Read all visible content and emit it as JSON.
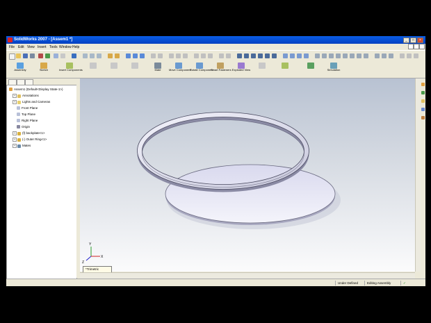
{
  "window": {
    "title": "SolidWorks 2007 - [Assem1 *]",
    "buttons": {
      "minimize": "_",
      "maximize": "□",
      "close": "×"
    }
  },
  "menu": {
    "items": [
      "File",
      "Edit",
      "View",
      "Insert",
      "Tools",
      "Window",
      "Help"
    ]
  },
  "command_manager": {
    "items": [
      {
        "label": "Assembly"
      },
      {
        "label": "Sketch"
      },
      {
        "label": "Insert Components"
      },
      {
        "label": "Mate"
      },
      {
        "label": "Move Component"
      },
      {
        "label": "Rotate Component"
      },
      {
        "label": "Smart Fasteners"
      },
      {
        "label": "Exploded View"
      },
      {
        "label": "Simulation"
      }
    ]
  },
  "feature_tree": {
    "nodes": [
      {
        "label": "Assem1 (Default<Display State-1>)",
        "icon": "assembly-icon"
      },
      {
        "label": "Annotations",
        "icon": "annotations-icon"
      },
      {
        "label": "Lights and Cameras",
        "icon": "lights-icon"
      },
      {
        "label": "Front Plane",
        "icon": "plane-icon"
      },
      {
        "label": "Top Plane",
        "icon": "plane-icon"
      },
      {
        "label": "Right Plane",
        "icon": "plane-icon"
      },
      {
        "label": "Origin",
        "icon": "origin-icon"
      },
      {
        "label": "(f) backplate<1>",
        "icon": "part-icon"
      },
      {
        "label": "(-) Outer Ring<1>",
        "icon": "part-icon"
      },
      {
        "label": "Mates",
        "icon": "mates-icon"
      }
    ]
  },
  "viewport": {
    "view_label": "*Trimetric",
    "triad": {
      "x": "X",
      "y": "Y",
      "z": "Z"
    }
  },
  "status": {
    "fields": [
      "Under Defined",
      "Editing Assembly"
    ]
  },
  "colors": {
    "titlebar": "#0a5ee8",
    "chrome": "#ece9d8",
    "part_face": "#e8e8f4",
    "part_edge": "#6a6a80"
  }
}
